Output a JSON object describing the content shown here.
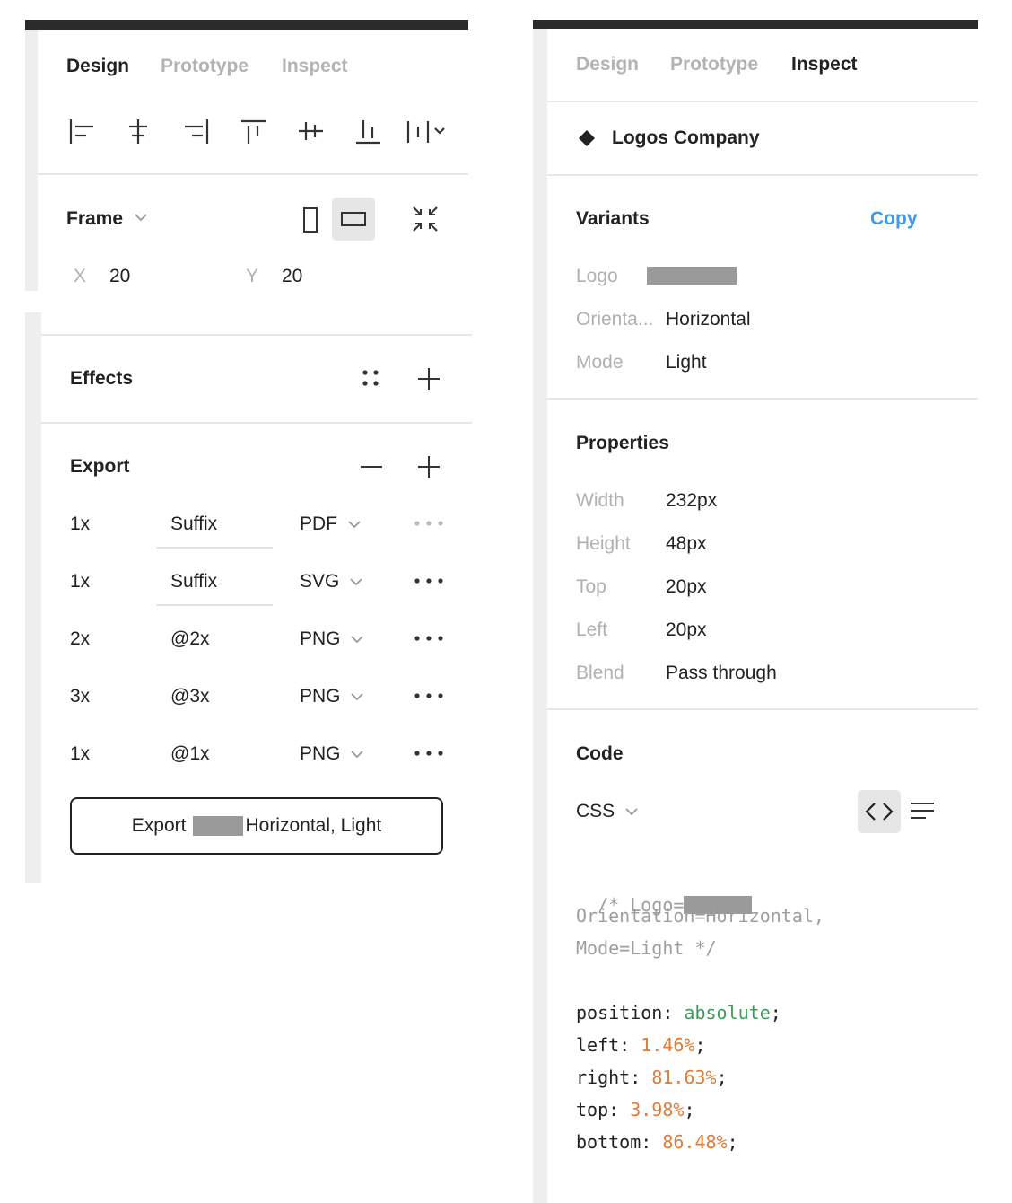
{
  "left": {
    "tabs": [
      {
        "label": "Design",
        "active": true
      },
      {
        "label": "Prototype",
        "active": false
      },
      {
        "label": "Inspect",
        "active": false
      }
    ],
    "align_icons": [
      "align-left-icon",
      "align-horizontal-center-icon",
      "align-right-icon",
      "align-top-icon",
      "align-vertical-center-icon",
      "align-bottom-icon",
      "distribute-icon"
    ],
    "frame": {
      "title": "Frame",
      "x_label": "X",
      "x_value": "20",
      "y_label": "Y",
      "y_value": "20"
    },
    "effects": {
      "title": "Effects"
    },
    "export": {
      "title": "Export",
      "rows": [
        {
          "scale": "1x",
          "suffix": "",
          "suffix_placeholder": "Suffix",
          "format": "PDF",
          "muted": true
        },
        {
          "scale": "1x",
          "suffix": "",
          "suffix_placeholder": "Suffix",
          "format": "SVG",
          "muted": false
        },
        {
          "scale": "2x",
          "suffix": "@2x",
          "suffix_placeholder": "",
          "format": "PNG",
          "muted": false
        },
        {
          "scale": "3x",
          "suffix": "@3x",
          "suffix_placeholder": "",
          "format": "PNG",
          "muted": false
        },
        {
          "scale": "1x",
          "suffix": "@1x",
          "suffix_placeholder": "",
          "format": "PNG",
          "muted": false
        }
      ],
      "button_prefix": "Export",
      "button_suffix": "Horizontal, Light"
    }
  },
  "right": {
    "tabs": [
      {
        "label": "Design",
        "active": false
      },
      {
        "label": "Prototype",
        "active": false
      },
      {
        "label": "Inspect",
        "active": true
      }
    ],
    "component_name": "Logos Company",
    "variants": {
      "title": "Variants",
      "copy_label": "Copy",
      "rows": [
        {
          "label": "Logo",
          "value": ""
        },
        {
          "label": "Orienta...",
          "value": "Horizontal"
        },
        {
          "label": "Mode",
          "value": "Light"
        }
      ]
    },
    "properties": {
      "title": "Properties",
      "rows": [
        {
          "label": "Width",
          "value": "232px"
        },
        {
          "label": "Height",
          "value": "48px"
        },
        {
          "label": "Top",
          "value": "20px"
        },
        {
          "label": "Left",
          "value": "20px"
        },
        {
          "label": "Blend",
          "value": "Pass through"
        }
      ]
    },
    "code": {
      "title": "Code",
      "language": "CSS",
      "comment_line1": "/* Logo=",
      "comment_line2": "Orientation=Horizontal,",
      "comment_line3": "Mode=Light */",
      "decls": [
        {
          "prop": "position",
          "value": "absolute",
          "kind": "keyword"
        },
        {
          "prop": "left",
          "value": "1.46%",
          "kind": "number"
        },
        {
          "prop": "right",
          "value": "81.63%",
          "kind": "number"
        },
        {
          "prop": "top",
          "value": "3.98%",
          "kind": "number"
        },
        {
          "prop": "bottom",
          "value": "86.48%",
          "kind": "number"
        }
      ]
    }
  }
}
